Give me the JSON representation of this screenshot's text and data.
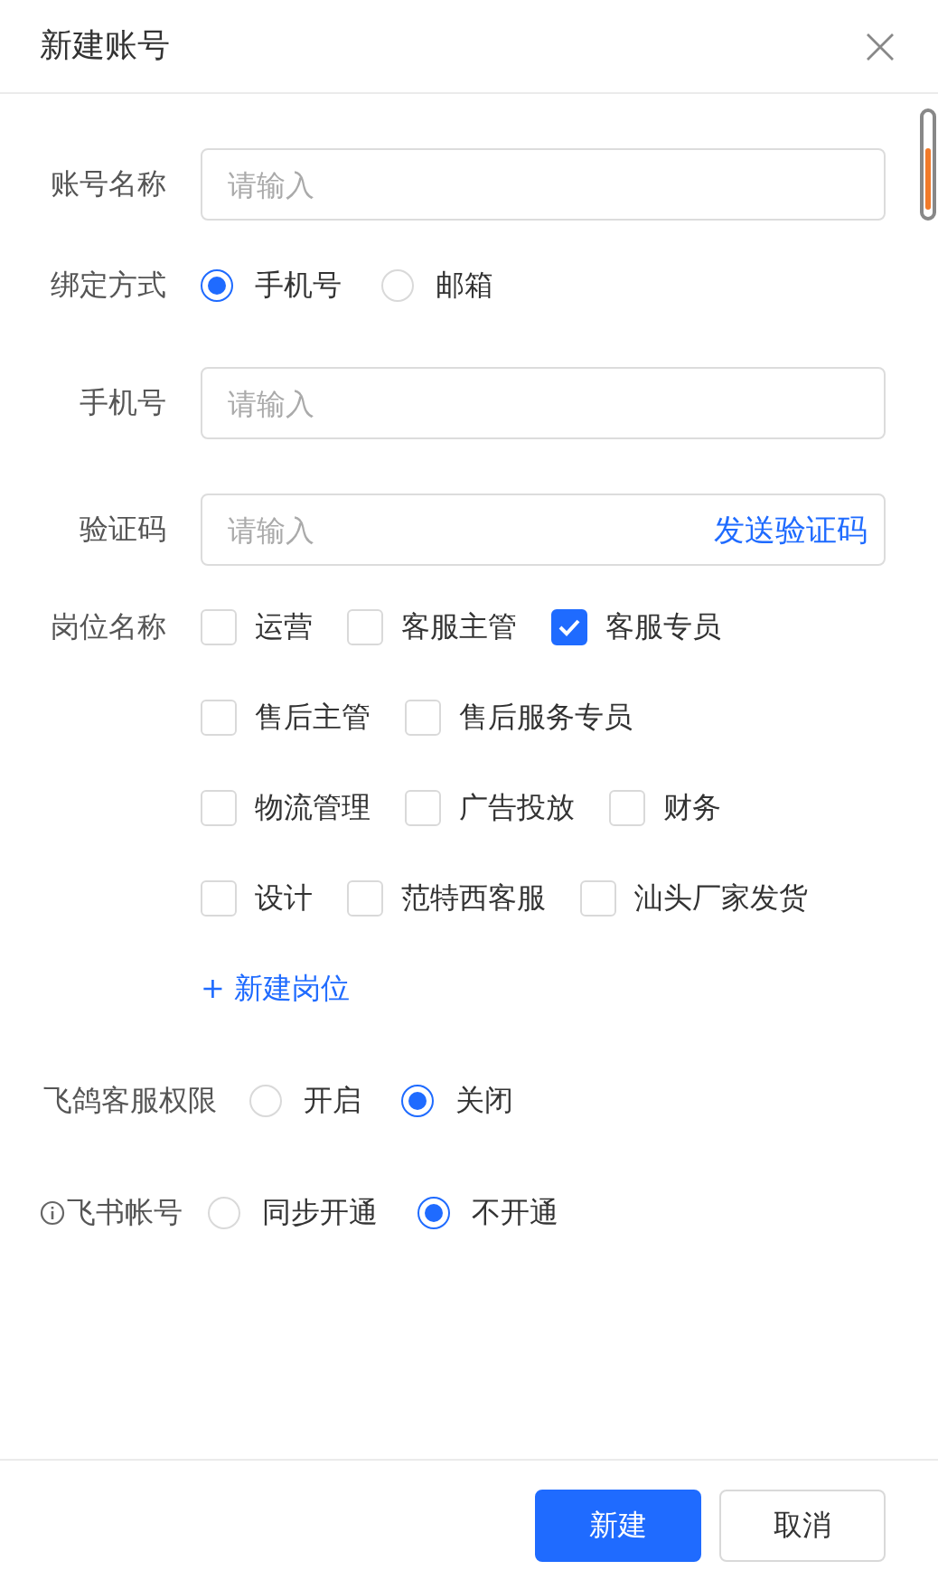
{
  "dialog": {
    "title": "新建账号"
  },
  "fields": [
    {
      "kind": "input",
      "label": "账号名称",
      "placeholder": "请输入"
    },
    {
      "kind": "radio",
      "label": "绑定方式",
      "options": [
        {
          "label": "手机号",
          "selected": true
        },
        {
          "label": "邮箱",
          "selected": false
        }
      ]
    },
    {
      "kind": "input",
      "label": "手机号",
      "placeholder": "请输入"
    },
    {
      "kind": "input",
      "label": "验证码",
      "placeholder": "请输入",
      "action": "发送验证码"
    },
    {
      "kind": "checkboxes",
      "label": "岗位名称",
      "rows": [
        [
          {
            "label": "运营",
            "checked": false
          },
          {
            "label": "客服主管",
            "checked": false
          },
          {
            "label": "客服专员",
            "checked": true
          }
        ],
        [
          {
            "label": "售后主管",
            "checked": false
          },
          {
            "label": "售后服务专员",
            "checked": false
          }
        ],
        [
          {
            "label": "物流管理",
            "checked": false
          },
          {
            "label": "广告投放",
            "checked": false
          },
          {
            "label": "财务",
            "checked": false
          }
        ],
        [
          {
            "label": "设计",
            "checked": false
          },
          {
            "label": "范特西客服",
            "checked": false
          },
          {
            "label": "汕头厂家发货",
            "checked": false
          }
        ]
      ],
      "add_link": "+ 新建岗位"
    }
  ],
  "extra_fields": [
    {
      "label": "飞鸽客服权限",
      "info": false,
      "options": [
        {
          "label": "开启",
          "selected": false
        },
        {
          "label": "关闭",
          "selected": true
        }
      ]
    },
    {
      "label": "飞书帐号",
      "info": true,
      "options": [
        {
          "label": "同步开通",
          "selected": false
        },
        {
          "label": "不开通",
          "selected": true
        }
      ]
    }
  ],
  "buttons": [
    {
      "label": "新建",
      "kind": "primary"
    },
    {
      "label": "取消",
      "kind": "default"
    }
  ]
}
